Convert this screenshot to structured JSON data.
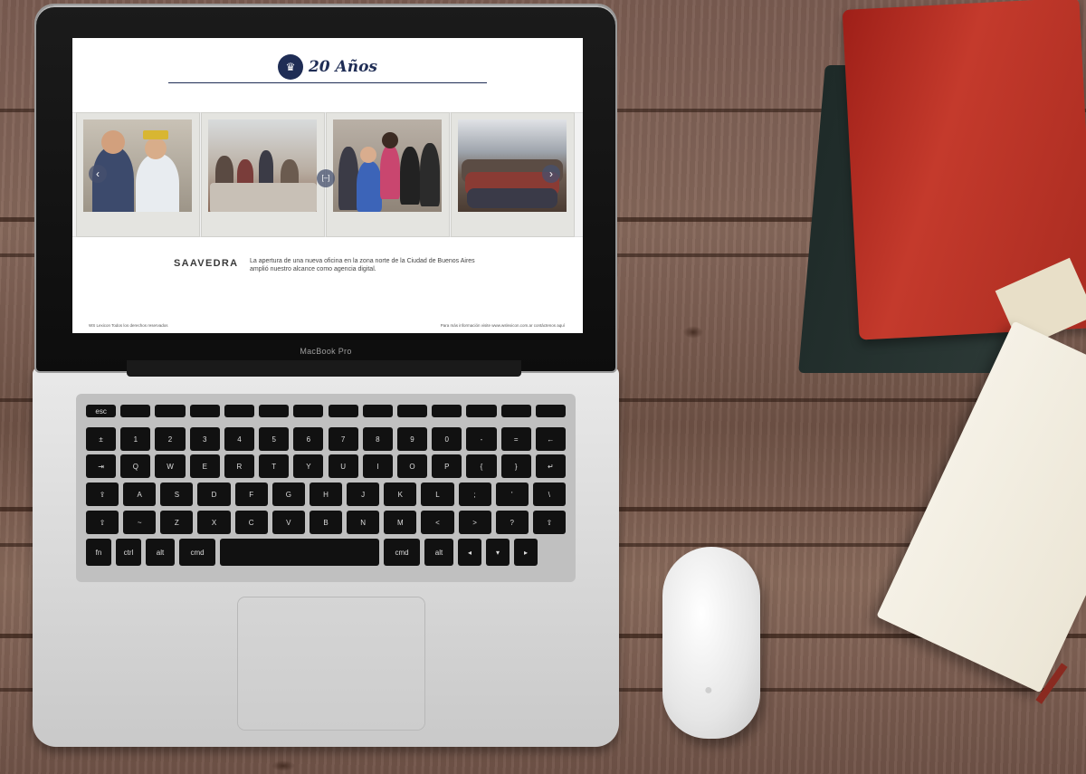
{
  "screen": {
    "logo_text": "20 Años",
    "section_title": "SAAVEDRA",
    "description": "La apertura de una nueva oficina en la zona norte de la Ciudad de Buenos Aires amplió nuestro alcance como agencia digital.",
    "gallery_prev": "‹",
    "gallery_next": "›",
    "gallery_expand": "[–]",
    "footer_left": "WS Lexicon Todos los derechos reservados",
    "footer_right": "Para más información visite www.wslexicon.com.ar contáctenos aquí"
  },
  "laptop": {
    "brand": "MacBook Pro"
  },
  "keyboard": {
    "rows": [
      [
        "esc",
        "",
        "",
        "",
        "",
        "",
        "",
        "",
        "",
        "",
        "",
        "",
        "",
        ""
      ],
      [
        "±",
        "1",
        "2",
        "3",
        "4",
        "5",
        "6",
        "7",
        "8",
        "9",
        "0",
        "-",
        "=",
        "←"
      ],
      [
        "⇥",
        "Q",
        "W",
        "E",
        "R",
        "T",
        "Y",
        "U",
        "I",
        "O",
        "P",
        "{",
        "}",
        "↵"
      ],
      [
        "⇪",
        "A",
        "S",
        "D",
        "F",
        "G",
        "H",
        "J",
        "K",
        "L",
        ";",
        "'",
        "\\"
      ],
      [
        "⇧",
        "~",
        "Z",
        "X",
        "C",
        "V",
        "B",
        "N",
        "M",
        "<",
        ">",
        "?",
        "⇧"
      ],
      [
        "fn",
        "ctrl",
        "alt",
        "cmd",
        "",
        "cmd",
        "alt",
        "◂",
        "▾",
        "▸"
      ]
    ]
  },
  "colors": {
    "brand_navy": "#1f2d55",
    "book_red": "#c43a2c",
    "desk_wood": "#7b5d52"
  }
}
